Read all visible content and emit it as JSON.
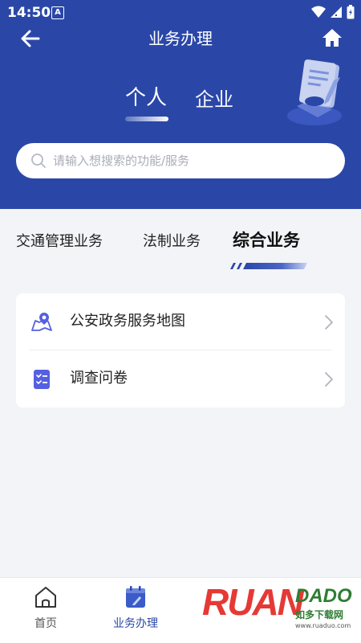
{
  "status_bar": {
    "time": "14:50",
    "notification_badge": "A"
  },
  "nav": {
    "title": "业务办理",
    "back_icon": "arrow-left-icon",
    "home_icon": "home-icon"
  },
  "mode_tabs": {
    "items": [
      {
        "label": "个人",
        "active": true
      },
      {
        "label": "企业",
        "active": false
      }
    ]
  },
  "search": {
    "placeholder": "请输入想搜索的功能/服务",
    "value": ""
  },
  "category_tabs": {
    "items": [
      {
        "label": "交通管理业务",
        "active": false
      },
      {
        "label": "法制业务",
        "active": false
      },
      {
        "label": "综合业务",
        "active": true
      }
    ]
  },
  "services": {
    "items": [
      {
        "label": "公安政务服务地图",
        "icon": "map-pin-icon"
      },
      {
        "label": "调查问卷",
        "icon": "checklist-icon"
      }
    ]
  },
  "bottom_nav": {
    "items": [
      {
        "label": "首页",
        "icon": "house-icon",
        "active": false
      },
      {
        "label": "业务办理",
        "icon": "calendar-edit-icon",
        "active": true
      }
    ]
  },
  "watermark": {
    "brand": "RUAN",
    "brand_tail": "DADO",
    "cn": "如多下载网",
    "url": "www.ruaduo.com"
  },
  "colors": {
    "header_bg": "#2a47a8",
    "accent": "#2a47a8",
    "page_bg": "#f3f4f8"
  }
}
